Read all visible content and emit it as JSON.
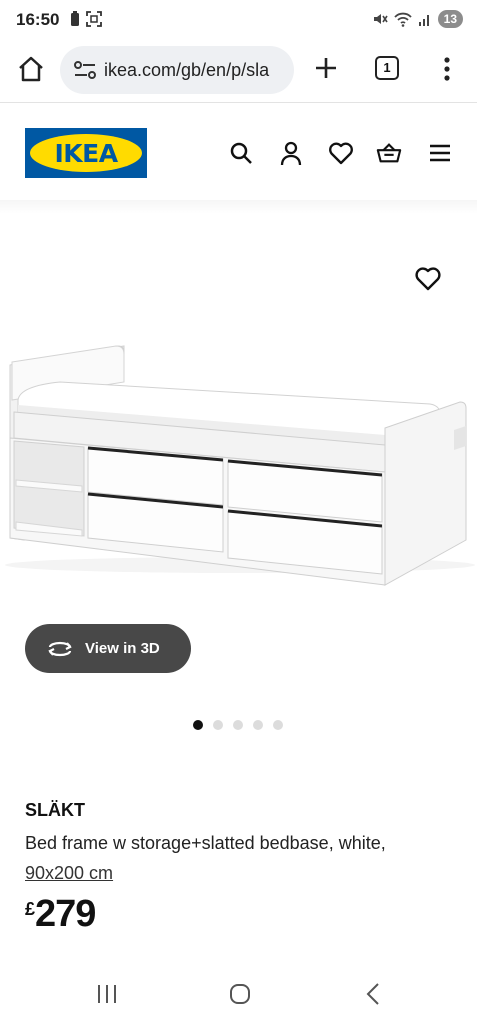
{
  "status_bar": {
    "time": "16:50",
    "battery_level": "13",
    "icons": [
      "battery-saver-icon",
      "screenshot-icon",
      "mute-icon",
      "wifi-icon",
      "signal-icon"
    ]
  },
  "browser": {
    "url": "ikea.com/gb/en/p/sla",
    "tab_count": "1"
  },
  "header": {
    "logo_text": "IKEA",
    "icons": [
      "search-icon",
      "account-icon",
      "favourites-icon",
      "basket-icon",
      "menu-icon"
    ]
  },
  "gallery": {
    "view_3d_label": "View in 3D",
    "image_count": 5,
    "active_index": 0
  },
  "product": {
    "name": "SLÄKT",
    "description": "Bed frame w storage+slatted bedbase, white,",
    "size": "90x200 cm",
    "price_currency": "£",
    "price_amount": "279"
  },
  "colors": {
    "ikea_blue": "#0058a3",
    "ikea_yellow": "#ffdb00",
    "view3d_bg": "#484848"
  }
}
